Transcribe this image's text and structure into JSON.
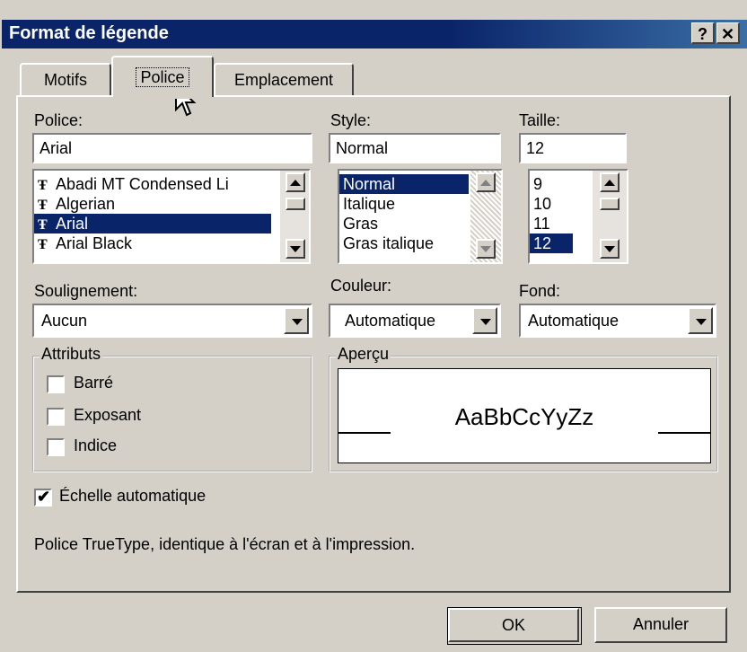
{
  "window": {
    "title": "Format de légende",
    "help_btn": "?",
    "close_btn": "✕"
  },
  "tabs": [
    {
      "label": "Motifs"
    },
    {
      "label": "Police"
    },
    {
      "label": "Emplacement"
    }
  ],
  "police": {
    "label": "Police:",
    "value": "Arial",
    "options": [
      "Abadi MT Condensed Li",
      "Algerian",
      "Arial",
      "Arial Black"
    ],
    "selected": "Arial"
  },
  "style": {
    "label": "Style:",
    "value": "Normal",
    "options": [
      "Normal",
      "Italique",
      "Gras",
      "Gras italique"
    ],
    "selected": "Normal"
  },
  "taille": {
    "label": "Taille:",
    "value": "12",
    "options": [
      "9",
      "10",
      "11",
      "12"
    ],
    "selected": "12"
  },
  "soulignement": {
    "label": "Soulignement:",
    "value": "Aucun"
  },
  "couleur": {
    "label": "Couleur:",
    "value": "Automatique"
  },
  "fond": {
    "label": "Fond:",
    "value": "Automatique"
  },
  "attributs": {
    "title": "Attributs",
    "items": [
      {
        "label": "Barré",
        "checked": false
      },
      {
        "label": "Exposant",
        "checked": false
      },
      {
        "label": "Indice",
        "checked": false
      }
    ]
  },
  "apercu": {
    "title": "Aperçu",
    "sample": "AaBbCcYyZz"
  },
  "echelle": {
    "label": "Échelle automatique",
    "checked": true
  },
  "info": "Police TrueType, identique à l'écran et à l'impression.",
  "buttons": {
    "ok": "OK",
    "cancel": "Annuler"
  }
}
